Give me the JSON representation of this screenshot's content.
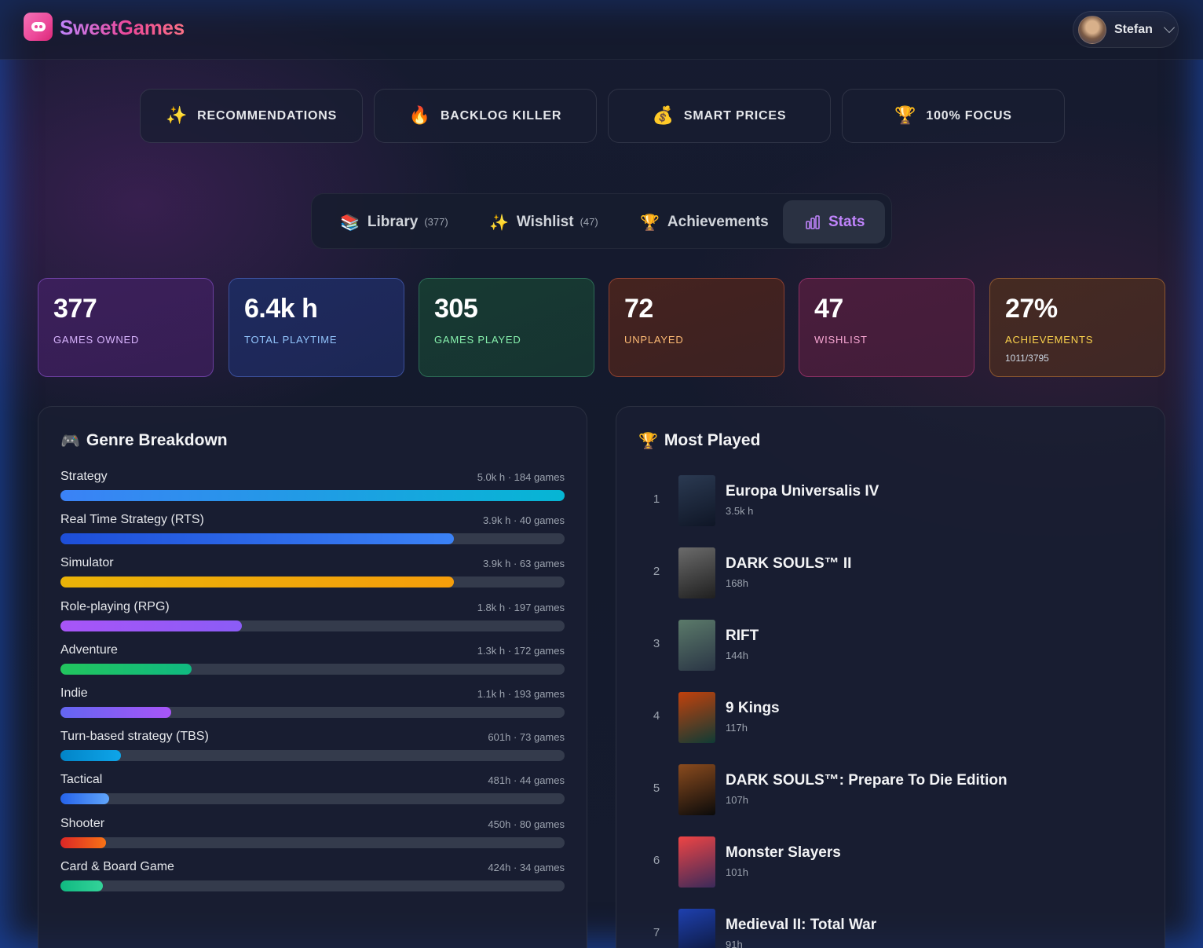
{
  "app": {
    "brand": "SweetGames",
    "user_name": "Stefan"
  },
  "features": [
    {
      "icon": "✨",
      "icon_name": "sparkles-icon",
      "label": "RECOMMENDATIONS"
    },
    {
      "icon": "🔥",
      "icon_name": "fire-icon",
      "label": "BACKLOG KILLER"
    },
    {
      "icon": "💰",
      "icon_name": "money-bag-icon",
      "label": "SMART PRICES"
    },
    {
      "icon": "🏆",
      "icon_name": "trophy-icon",
      "label": "100% FOCUS"
    }
  ],
  "tabs": [
    {
      "icon": "📚",
      "icon_name": "books-icon",
      "label": "Library",
      "count": "(377)"
    },
    {
      "icon": "✨",
      "icon_name": "sparkles-icon",
      "label": "Wishlist",
      "count": "(47)"
    },
    {
      "icon": "🏆",
      "icon_name": "trophy-icon",
      "label": "Achievements",
      "count": ""
    },
    {
      "icon": "",
      "icon_name": "bar-chart-icon",
      "label": "Stats",
      "count": "",
      "active": true
    }
  ],
  "stats": [
    {
      "value": "377",
      "label": "GAMES OWNED",
      "sub": "",
      "label_color": "#d8b4fe",
      "bg": "#3b1f5a",
      "border": "#6b3fa0"
    },
    {
      "value": "6.4k h",
      "label": "TOTAL PLAYTIME",
      "sub": "",
      "label_color": "#93c5fd",
      "bg": "#1e2a5e",
      "border": "#3b4f9a"
    },
    {
      "value": "305",
      "label": "GAMES PLAYED",
      "sub": "",
      "label_color": "#86efac",
      "bg": "#173a32",
      "border": "#2c6a55"
    },
    {
      "value": "72",
      "label": "UNPLAYED",
      "sub": "",
      "label_color": "#fdba74",
      "bg": "#45231f",
      "border": "#8a4030"
    },
    {
      "value": "47",
      "label": "WISHLIST",
      "sub": "",
      "label_color": "#f9a8d4",
      "bg": "#4a1d3c",
      "border": "#8a2f63"
    },
    {
      "value": "27%",
      "label": "ACHIEVEMENTS",
      "sub": "1011/3795",
      "label_color": "#fcd34d",
      "bg": "#452a22",
      "border": "#8a5630"
    }
  ],
  "genre_panel": {
    "icon": "🎮",
    "icon_name": "game-controller-icon",
    "title": "Genre Breakdown",
    "genres": [
      {
        "name": "Strategy",
        "meta": "5.0k h · 184 games",
        "hours": 5000,
        "grad": [
          "#3b82f6",
          "#06b6d4"
        ]
      },
      {
        "name": "Real Time Strategy (RTS)",
        "meta": "3.9k h · 40 games",
        "hours": 3900,
        "grad": [
          "#1d4ed8",
          "#3b82f6"
        ]
      },
      {
        "name": "Simulator",
        "meta": "3.9k h · 63 games",
        "hours": 3900,
        "grad": [
          "#eab308",
          "#f59e0b"
        ]
      },
      {
        "name": "Role-playing (RPG)",
        "meta": "1.8k h · 197 games",
        "hours": 1800,
        "grad": [
          "#a855f7",
          "#8b5cf6"
        ]
      },
      {
        "name": "Adventure",
        "meta": "1.3k h · 172 games",
        "hours": 1300,
        "grad": [
          "#22c55e",
          "#10b981"
        ]
      },
      {
        "name": "Indie",
        "meta": "1.1k h · 193 games",
        "hours": 1100,
        "grad": [
          "#6366f1",
          "#a855f7"
        ]
      },
      {
        "name": "Turn-based strategy (TBS)",
        "meta": "601h · 73 games",
        "hours": 601,
        "grad": [
          "#0284c7",
          "#0ea5e9"
        ]
      },
      {
        "name": "Tactical",
        "meta": "481h · 44 games",
        "hours": 481,
        "grad": [
          "#2563eb",
          "#60a5fa"
        ]
      },
      {
        "name": "Shooter",
        "meta": "450h · 80 games",
        "hours": 450,
        "grad": [
          "#dc2626",
          "#f97316"
        ]
      },
      {
        "name": "Card & Board Game",
        "meta": "424h · 34 games",
        "hours": 424,
        "grad": [
          "#10b981",
          "#34d399"
        ]
      }
    ]
  },
  "most_played": {
    "icon": "🏆",
    "icon_name": "trophy-icon",
    "title": "Most Played",
    "games": [
      {
        "rank": "1",
        "title": "Europa Universalis IV",
        "hours": "3.5k h",
        "cover": [
          "#2b3a52",
          "#0f1626"
        ]
      },
      {
        "rank": "2",
        "title": "DARK SOULS™ II",
        "hours": "168h",
        "cover": [
          "#6b6b6b",
          "#1f1f1f"
        ]
      },
      {
        "rank": "3",
        "title": "RIFT",
        "hours": "144h",
        "cover": [
          "#5b7a6a",
          "#2a3545"
        ]
      },
      {
        "rank": "4",
        "title": "9 Kings",
        "hours": "117h",
        "cover": [
          "#c2410c",
          "#0f3b35"
        ]
      },
      {
        "rank": "5",
        "title": "DARK SOULS™: Prepare To Die Edition",
        "hours": "107h",
        "cover": [
          "#8a4b1e",
          "#0a0a0a"
        ]
      },
      {
        "rank": "6",
        "title": "Monster Slayers",
        "hours": "101h",
        "cover": [
          "#ef4444",
          "#3b2a5a"
        ]
      },
      {
        "rank": "7",
        "title": "Medieval II: Total War",
        "hours": "91h",
        "cover": [
          "#1e40af",
          "#0b1430"
        ]
      }
    ]
  }
}
